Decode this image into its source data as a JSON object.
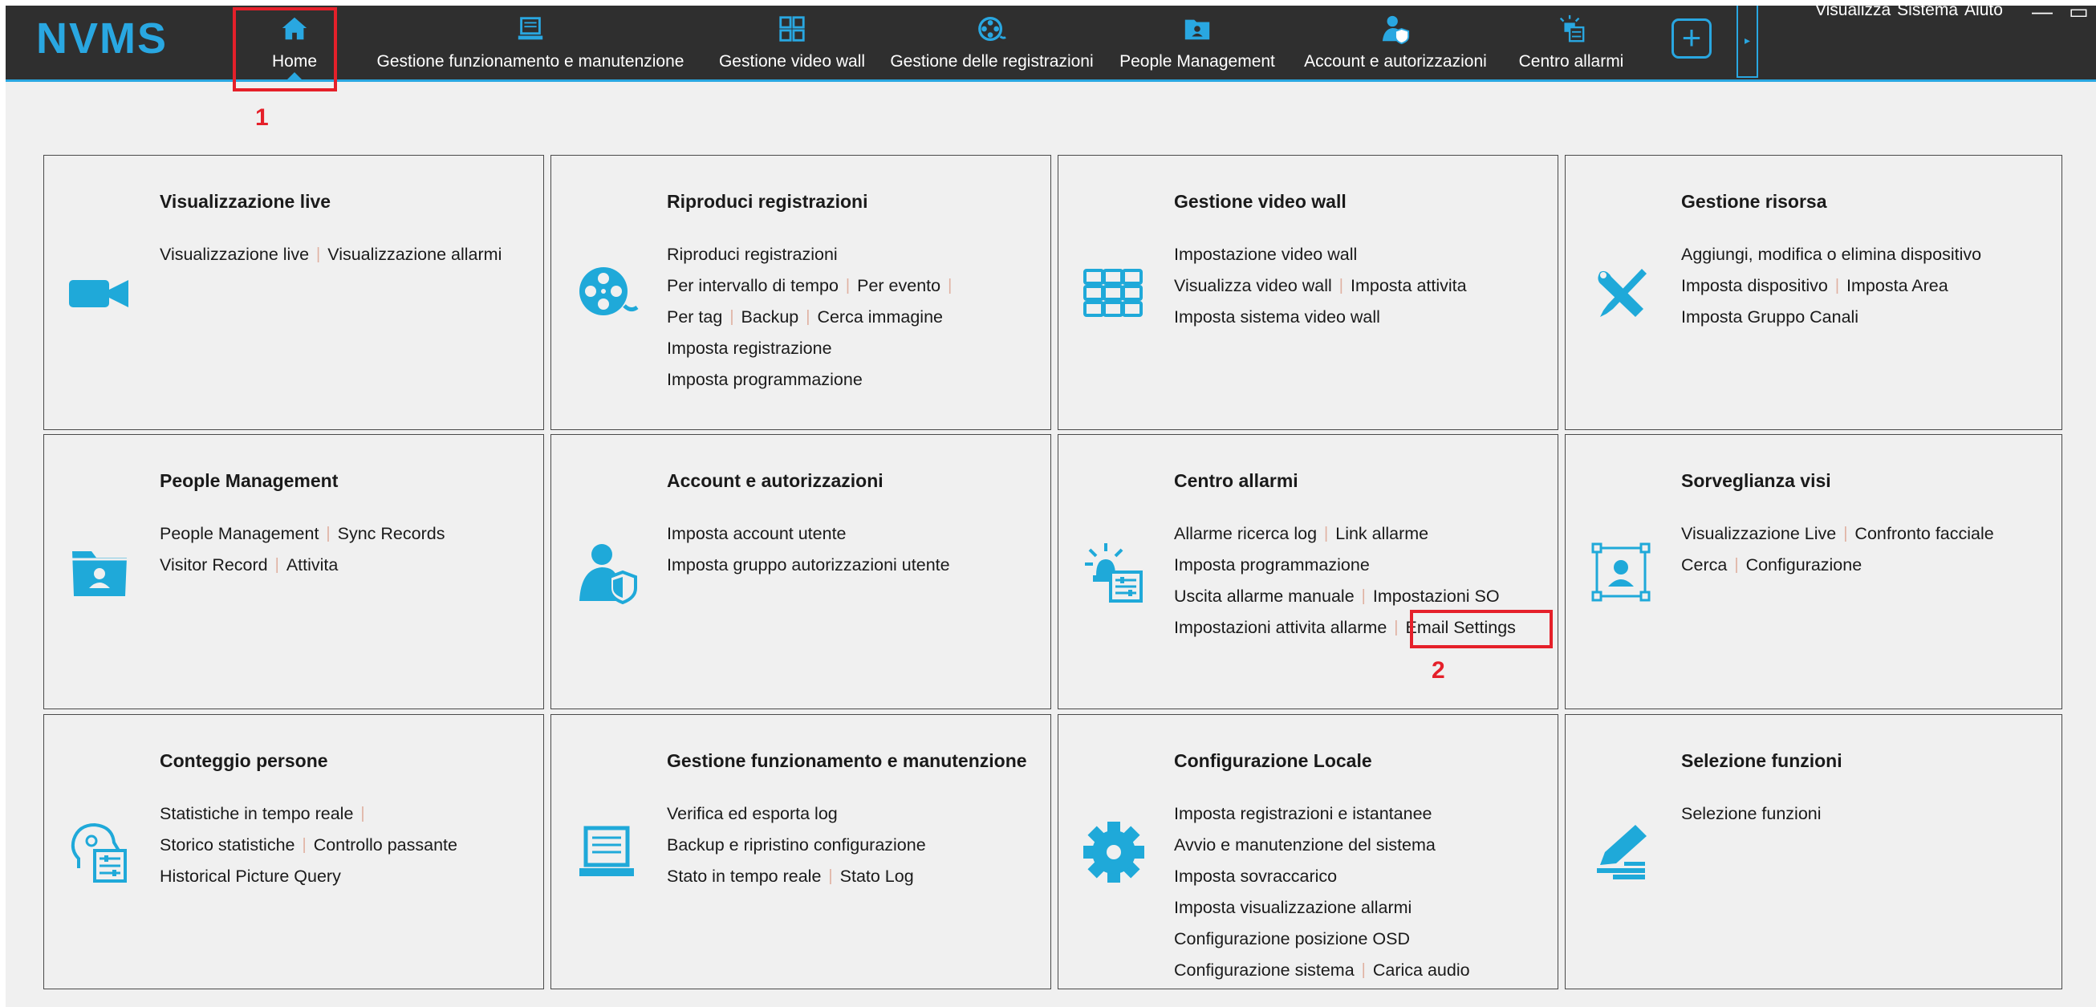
{
  "app": {
    "logo": "NVMS",
    "right_menu": [
      "Visualizza",
      "Sistema",
      "Aiuto"
    ],
    "window_controls": [
      "—",
      "▭"
    ]
  },
  "nav": [
    {
      "label": "Home",
      "icon": "home-icon",
      "active": true
    },
    {
      "label": "Gestione funzionamento e manutenzione",
      "icon": "laptop-icon"
    },
    {
      "label": "Gestione video wall",
      "icon": "video-wall-icon"
    },
    {
      "label": "Gestione delle registrazioni",
      "icon": "film-reel-icon"
    },
    {
      "label": "People Management",
      "icon": "person-folder-icon"
    },
    {
      "label": "Account e autorizzazioni",
      "icon": "user-shield-icon"
    },
    {
      "label": "Centro allarmi",
      "icon": "alarm-icon"
    }
  ],
  "add_button": "+",
  "collapse_tab": "▸",
  "tiles": [
    {
      "title": "Visualizzazione live",
      "icon": "camera-icon",
      "rows": [
        [
          "Visualizzazione live",
          "Visualizzazione allarmi"
        ]
      ]
    },
    {
      "title": "Riproduci registrazioni",
      "icon": "film-reel-icon",
      "rows": [
        [
          "Riproduci registrazioni"
        ],
        [
          "Per intervallo di tempo",
          "Per evento",
          ""
        ],
        [
          "Per tag",
          "Backup",
          "Cerca immagine"
        ],
        [
          "Imposta registrazione"
        ],
        [
          "Imposta programmazione"
        ]
      ]
    },
    {
      "title": "Gestione video wall",
      "icon": "video-wall-icon",
      "rows": [
        [
          "Impostazione video wall"
        ],
        [
          "Visualizza video wall",
          "Imposta attivita"
        ],
        [
          "Imposta sistema video wall"
        ]
      ]
    },
    {
      "title": "Gestione risorsa",
      "icon": "tools-icon",
      "rows": [
        [
          "Aggiungi, modifica o elimina dispositivo"
        ],
        [
          "Imposta dispositivo",
          "Imposta Area"
        ],
        [
          "Imposta Gruppo Canali"
        ]
      ]
    },
    {
      "title": "People Management",
      "icon": "person-folder-icon",
      "rows": [
        [
          "People Management",
          "Sync Records"
        ],
        [
          "Visitor Record",
          "Attivita"
        ]
      ]
    },
    {
      "title": "Account e autorizzazioni",
      "icon": "user-shield-icon",
      "rows": [
        [
          "Imposta account utente"
        ],
        [
          "Imposta gruppo autorizzazioni utente"
        ]
      ]
    },
    {
      "title": "Centro allarmi",
      "icon": "alarm-icon",
      "rows": [
        [
          "Allarme ricerca log",
          "Link allarme"
        ],
        [
          "Imposta programmazione"
        ],
        [
          "Uscita allarme manuale",
          "Impostazioni SO"
        ],
        [
          "Impostazioni attivita allarme",
          "Email Settings"
        ]
      ]
    },
    {
      "title": "Sorveglianza visi",
      "icon": "face-frame-icon",
      "rows": [
        [
          "Visualizzazione Live",
          "Confronto facciale"
        ],
        [
          "Cerca",
          "Configurazione"
        ]
      ]
    },
    {
      "title": "Conteggio persone",
      "icon": "head-stats-icon",
      "rows": [
        [
          "Statistiche in tempo reale",
          ""
        ],
        [
          "Storico statistiche",
          "Controllo passante"
        ],
        [
          "Historical Picture Query"
        ]
      ]
    },
    {
      "title": "Gestione funzionamento e manutenzione",
      "icon": "laptop-icon",
      "rows": [
        [
          "Verifica ed esporta log"
        ],
        [
          "Backup e ripristino configurazione"
        ],
        [
          "Stato in tempo reale",
          "Stato Log"
        ]
      ]
    },
    {
      "title": "Configurazione Locale",
      "icon": "gear-icon",
      "rows": [
        [
          "Imposta registrazioni e istantanee"
        ],
        [
          "Avvio e manutenzione del sistema"
        ],
        [
          "Imposta sovraccarico"
        ],
        [
          "Imposta visualizzazione allarmi"
        ],
        [
          "Configurazione posizione OSD"
        ],
        [
          "Configurazione sistema",
          "Carica audio"
        ]
      ]
    },
    {
      "title": "Selezione funzioni",
      "icon": "edit-list-icon",
      "rows": [
        [
          "Selezione funzioni"
        ]
      ]
    }
  ],
  "annotations": [
    {
      "number": "1",
      "target": "Home"
    },
    {
      "number": "2",
      "target": "Email Settings"
    }
  ],
  "colors": {
    "accent": "#29a7e1",
    "topbar": "#2f2f2f",
    "content_bg": "#f0f0f0",
    "annotation": "#e5202a",
    "separator": "#e0b0a0"
  }
}
